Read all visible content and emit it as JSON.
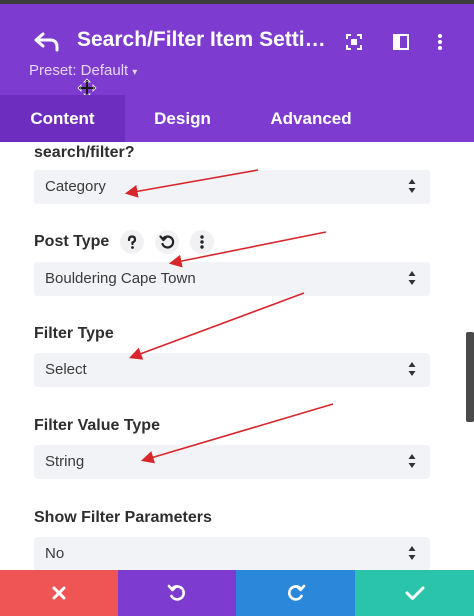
{
  "header": {
    "title": "Search/Filter Item Settings",
    "preset_label": "Preset: Default",
    "preset_caret": "▾",
    "icons": [
      "back-icon",
      "fullscreen-icon",
      "split-view-icon",
      "more-vertical-icon",
      "move-icon"
    ]
  },
  "tabs": [
    {
      "label": "Content",
      "active": true
    },
    {
      "label": "Design",
      "active": false
    },
    {
      "label": "Advanced",
      "active": false
    }
  ],
  "fields": [
    {
      "label": "search/filter?",
      "value": "Category"
    },
    {
      "label": "Post Type",
      "value": "Bouldering Cape Town",
      "help_icons": [
        "help-icon",
        "reset-icon",
        "more-vertical-icon"
      ]
    },
    {
      "label": "Filter Type",
      "value": "Select"
    },
    {
      "label": "Filter Value Type",
      "value": "String"
    },
    {
      "label": "Show Filter Parameters",
      "value": "No"
    }
  ],
  "footer": {
    "buttons": [
      "close-icon",
      "undo-icon",
      "redo-icon",
      "check-icon"
    ]
  },
  "colors": {
    "header_purple": "#7e3bd0",
    "tab_active": "#6d2ec0",
    "cancel_red": "#ef5555",
    "undo_purple": "#7e3bd0",
    "redo_blue": "#2b87da",
    "save_teal": "#29c4a9",
    "annotation_arrow": "#d9262b"
  }
}
